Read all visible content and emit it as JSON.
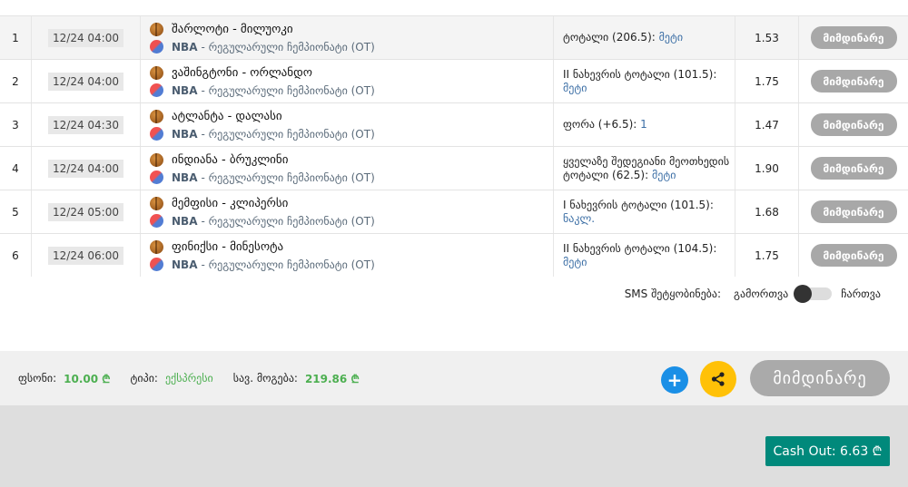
{
  "rows": [
    {
      "num": "1",
      "date": "12/24 04:00",
      "match": "შარლოტი - მილუოკი",
      "league_name": "NBA",
      "league_rest": "- რეგულარული ჩემპიონატი (OT)",
      "bet_text": "ტოტალი (206.5):",
      "bet_pick": "მეტი",
      "odds": "1.53",
      "status": "მიმდინარე"
    },
    {
      "num": "2",
      "date": "12/24 04:00",
      "match": "ვაშინგტონი - ორლანდო",
      "league_name": "NBA",
      "league_rest": "- რეგულარული ჩემპიონატი (OT)",
      "bet_text": "II ნახევრის ტოტალი (101.5):",
      "bet_pick": "მეტი",
      "odds": "1.75",
      "status": "მიმდინარე"
    },
    {
      "num": "3",
      "date": "12/24 04:30",
      "match": "ატლანტა - დალასი",
      "league_name": "NBA",
      "league_rest": "- რეგულარული ჩემპიონატი (OT)",
      "bet_text": "ფორა (+6.5):",
      "bet_pick": "1",
      "odds": "1.47",
      "status": "მიმდინარე"
    },
    {
      "num": "4",
      "date": "12/24 04:00",
      "match": "ინდიანა - ბრუკლინი",
      "league_name": "NBA",
      "league_rest": "- რეგულარული ჩემპიონატი (OT)",
      "bet_text": "ყველაზე შედეგიანი მეოთხედის ტოტალი (62.5):",
      "bet_pick": "მეტი",
      "odds": "1.90",
      "status": "მიმდინარე"
    },
    {
      "num": "5",
      "date": "12/24 05:00",
      "match": "მემფისი - კლიპერსი",
      "league_name": "NBA",
      "league_rest": "- რეგულარული ჩემპიონატი (OT)",
      "bet_text": "I ნახევრის ტოტალი (101.5):",
      "bet_pick": "ნაკლ.",
      "odds": "1.68",
      "status": "მიმდინარე"
    },
    {
      "num": "6",
      "date": "12/24 06:00",
      "match": "ფინიქსი - მინესოტა",
      "league_name": "NBA",
      "league_rest": "- რეგულარული ჩემპიონატი (OT)",
      "bet_text": "II ნახევრის ტოტალი (104.5):",
      "bet_pick": "მეტი",
      "odds": "1.75",
      "status": "მიმდინარე"
    }
  ],
  "sms": {
    "label": "SMS შეტყობინება:",
    "off": "გამორთვა",
    "on": "ჩართვა"
  },
  "summary": {
    "stake_label": "ფსონი:",
    "stake_value": "10.00 ₾",
    "type_label": "ტიპი:",
    "type_value": "ექსპრესი",
    "win_label": "სავ. მოგება:",
    "win_value": "219.86 ₾"
  },
  "actions": {
    "plus": "+",
    "status": "მიმდინარე",
    "cashout": "Cash Out: 6.63 ₾"
  },
  "colors": {
    "accent_green": "#4caf50",
    "cashout_bg": "#00897b",
    "share_bg": "#ffc107",
    "plus_bg": "#1a8fe6",
    "pill_bg": "#a8a8a8"
  }
}
